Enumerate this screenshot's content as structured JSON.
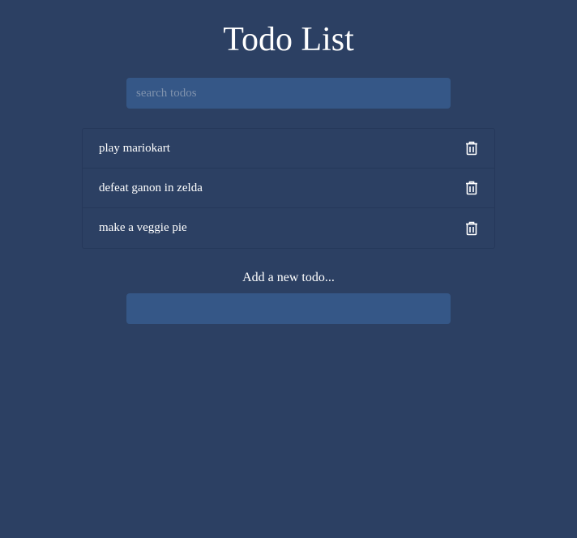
{
  "page": {
    "title": "Todo List",
    "background": "#2c4063"
  },
  "search": {
    "placeholder": "search todos",
    "value": ""
  },
  "todos": [
    {
      "text": "play mariokart",
      "icon": "trash-icon"
    },
    {
      "text": "defeat ganon in zelda",
      "icon": "trash-icon"
    },
    {
      "text": "make a veggie pie",
      "icon": "trash-icon"
    }
  ],
  "add_form": {
    "label": "Add a new todo...",
    "value": ""
  }
}
